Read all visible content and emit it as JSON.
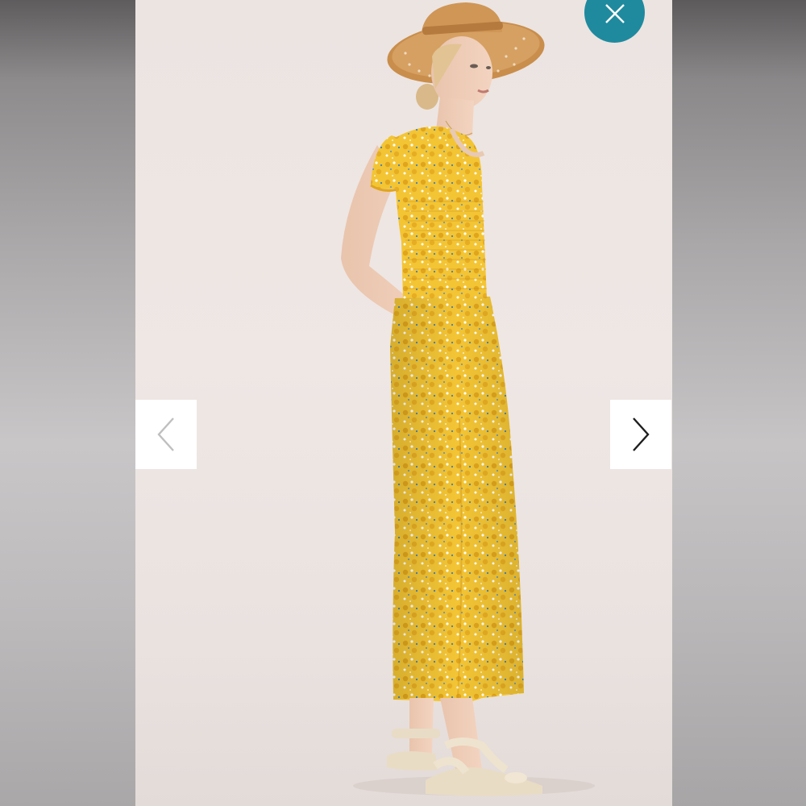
{
  "viewer": {
    "image_alt": "",
    "colors": {
      "close_button": "#1f8a9e",
      "nav_button": "#ffffff",
      "photo_background": "#ece4e1",
      "garment": "#f2c232"
    },
    "icons": {
      "close": "close-icon",
      "previous": "chevron-left-icon",
      "next": "chevron-right-icon"
    }
  }
}
